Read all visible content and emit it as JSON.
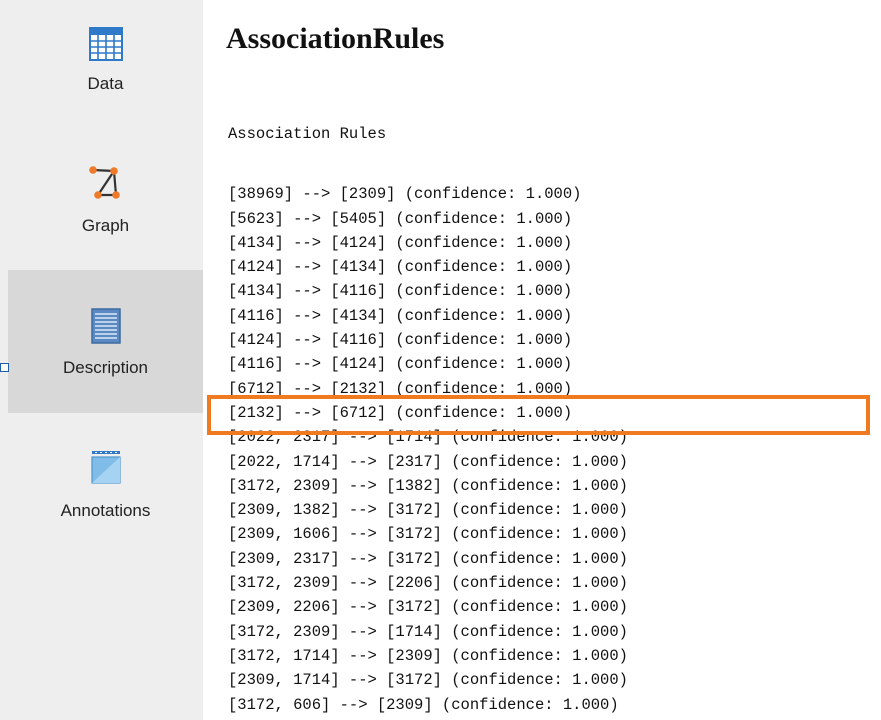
{
  "sidebar": {
    "items": [
      {
        "label": "Data",
        "icon": "table-grid-icon"
      },
      {
        "label": "Graph",
        "icon": "graph-icon"
      },
      {
        "label": "Description",
        "icon": "document-icon",
        "active": true
      },
      {
        "label": "Annotations",
        "icon": "annotation-icon"
      }
    ]
  },
  "main": {
    "title": "AssociationRules",
    "rules_heading": "Association Rules",
    "rules": [
      "[38969] --> [2309] (confidence: 1.000)",
      "[5623] --> [5405] (confidence: 1.000)",
      "[4134] --> [4124] (confidence: 1.000)",
      "[4124] --> [4134] (confidence: 1.000)",
      "[4134] --> [4116] (confidence: 1.000)",
      "[4116] --> [4134] (confidence: 1.000)",
      "[4124] --> [4116] (confidence: 1.000)",
      "[4116] --> [4124] (confidence: 1.000)",
      "[6712] --> [2132] (confidence: 1.000)",
      "[2132] --> [6712] (confidence: 1.000)",
      "[2022, 2317] --> [1714] (confidence: 1.000)",
      "[2022, 1714] --> [2317] (confidence: 1.000)",
      "[3172, 2309] --> [1382] (confidence: 1.000)",
      "[2309, 1382] --> [3172] (confidence: 1.000)",
      "[2309, 1606] --> [3172] (confidence: 1.000)",
      "[2309, 2317] --> [3172] (confidence: 1.000)",
      "[3172, 2309] --> [2206] (confidence: 1.000)",
      "[2309, 2206] --> [3172] (confidence: 1.000)",
      "[3172, 2309] --> [1714] (confidence: 1.000)",
      "[3172, 1714] --> [2309] (confidence: 1.000)",
      "[2309, 1714] --> [3172] (confidence: 1.000)",
      "[3172, 606] --> [2309] (confidence: 1.000)"
    ],
    "highlighted_rule": "[2022, 2317] --> [1714] (confidence: 1.000)"
  },
  "colors": {
    "sidebar_bg": "#eeeeee",
    "active_item_bg": "#d8d8d8",
    "highlight": "#f07a1f",
    "icon_blue": "#2f79c9"
  }
}
